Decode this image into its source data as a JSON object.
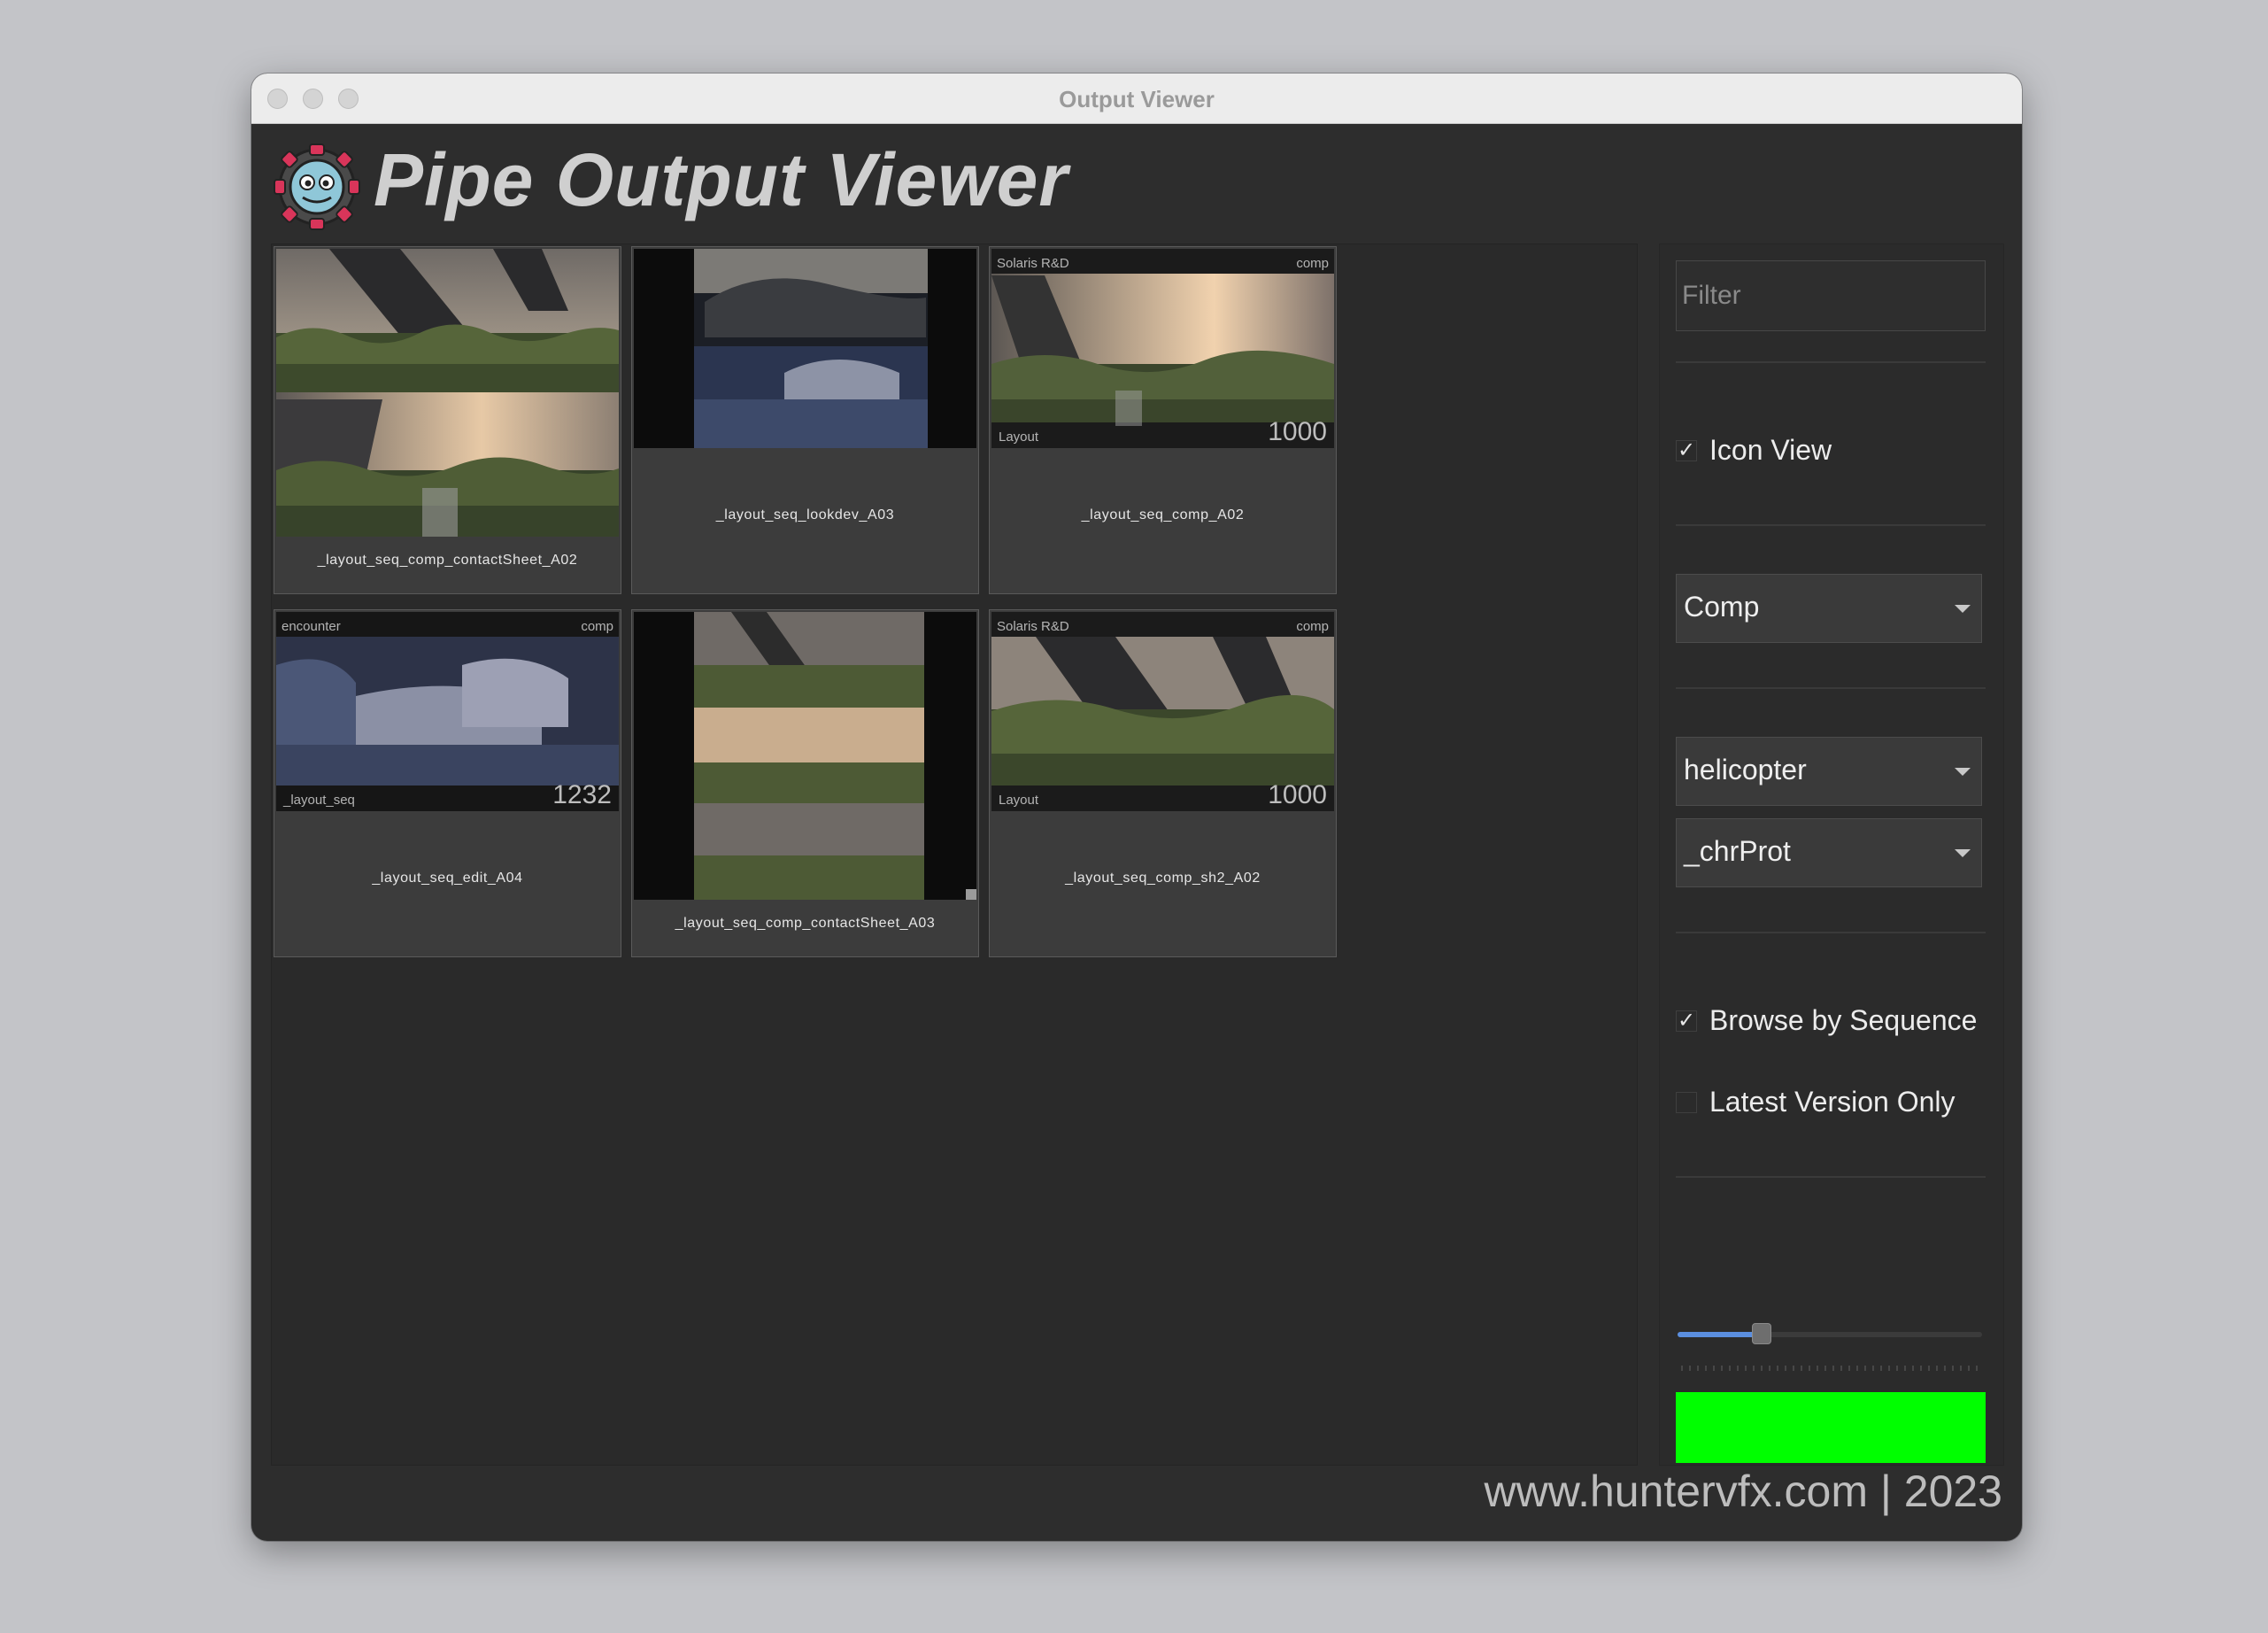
{
  "window": {
    "title": "Output Viewer"
  },
  "header": {
    "title": "Pipe Output Viewer",
    "logo_icon": "robot-gear-icon"
  },
  "gallery": {
    "items": [
      {
        "label": "_layout_seq_comp_contactSheet_A02",
        "overlay": {}
      },
      {
        "label": "_layout_seq_lookdev_A03",
        "overlay": {}
      },
      {
        "label": "_layout_seq_comp_A02",
        "overlay": {
          "top_left": "Solaris R&D",
          "top_right": "comp",
          "bottom_left": "Layout",
          "frame": "1000"
        }
      },
      {
        "label": "_layout_seq_edit_A04",
        "overlay": {
          "top_left": "encounter",
          "top_right": "comp",
          "bottom_left": "_layout_seq",
          "frame": "1232"
        }
      },
      {
        "label": "_layout_seq_comp_contactSheet_A03",
        "overlay": {}
      },
      {
        "label": "_layout_seq_comp_sh2_A02",
        "overlay": {
          "top_left": "Solaris R&D",
          "top_right": "comp",
          "bottom_left": "Layout",
          "frame": "1000"
        }
      }
    ]
  },
  "panel": {
    "filter_placeholder": "Filter",
    "icon_view": {
      "label": "Icon View",
      "checked": true,
      "mark": "✓"
    },
    "department": {
      "value": "Comp"
    },
    "asset": {
      "value": "helicopter"
    },
    "variant": {
      "value": "_chrProt"
    },
    "browse_by_sequence": {
      "label": "Browse by Sequence",
      "checked": true,
      "mark": "✓"
    },
    "latest_version_only": {
      "label": "Latest Version Only",
      "checked": false
    },
    "thumbnail_size": {
      "value_fraction": 0.26
    },
    "status_color": "#00ff00"
  },
  "footer": {
    "text": "www.huntervfx.com | 2023"
  }
}
